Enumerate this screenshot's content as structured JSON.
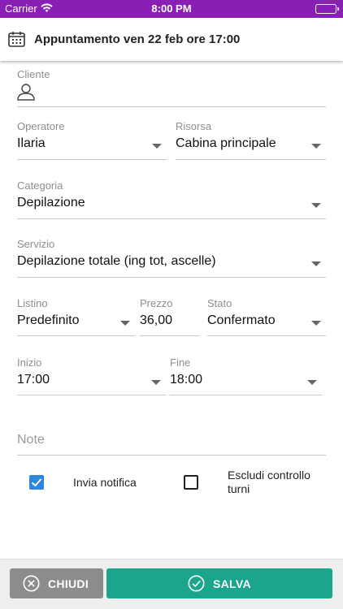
{
  "status_bar": {
    "carrier": "Carrier",
    "time": "8:00 PM"
  },
  "header": {
    "title": "Appuntamento ven 22 feb ore 17:00",
    "icon": "calendar-icon"
  },
  "form": {
    "cliente": {
      "label": "Cliente",
      "value": ""
    },
    "operatore": {
      "label": "Operatore",
      "value": "Ilaria"
    },
    "risorsa": {
      "label": "Risorsa",
      "value": "Cabina principale"
    },
    "categoria": {
      "label": "Categoria",
      "value": "Depilazione"
    },
    "servizio": {
      "label": "Servizio",
      "value": "Depilazione totale (ing tot, ascelle)"
    },
    "listino": {
      "label": "Listino",
      "value": "Predefinito"
    },
    "prezzo": {
      "label": "Prezzo",
      "value": "36,00"
    },
    "stato": {
      "label": "Stato",
      "value": "Confermato"
    },
    "inizio": {
      "label": "Inizio",
      "value": "17:00"
    },
    "fine": {
      "label": "Fine",
      "value": "18:00"
    },
    "note": {
      "placeholder": "Note"
    },
    "invia_notifica": {
      "label": "Invia notifica",
      "checked": true
    },
    "escludi_controllo": {
      "label_line1": "Escludi controllo",
      "label_line2": "turni",
      "checked": false
    }
  },
  "footer": {
    "close_label": "CHIUDI",
    "save_label": "SALVA"
  },
  "colors": {
    "status_bar": "#8a1fb5",
    "save": "#1aa58c",
    "close": "#8c8c8c",
    "checkbox": "#2e86de"
  }
}
